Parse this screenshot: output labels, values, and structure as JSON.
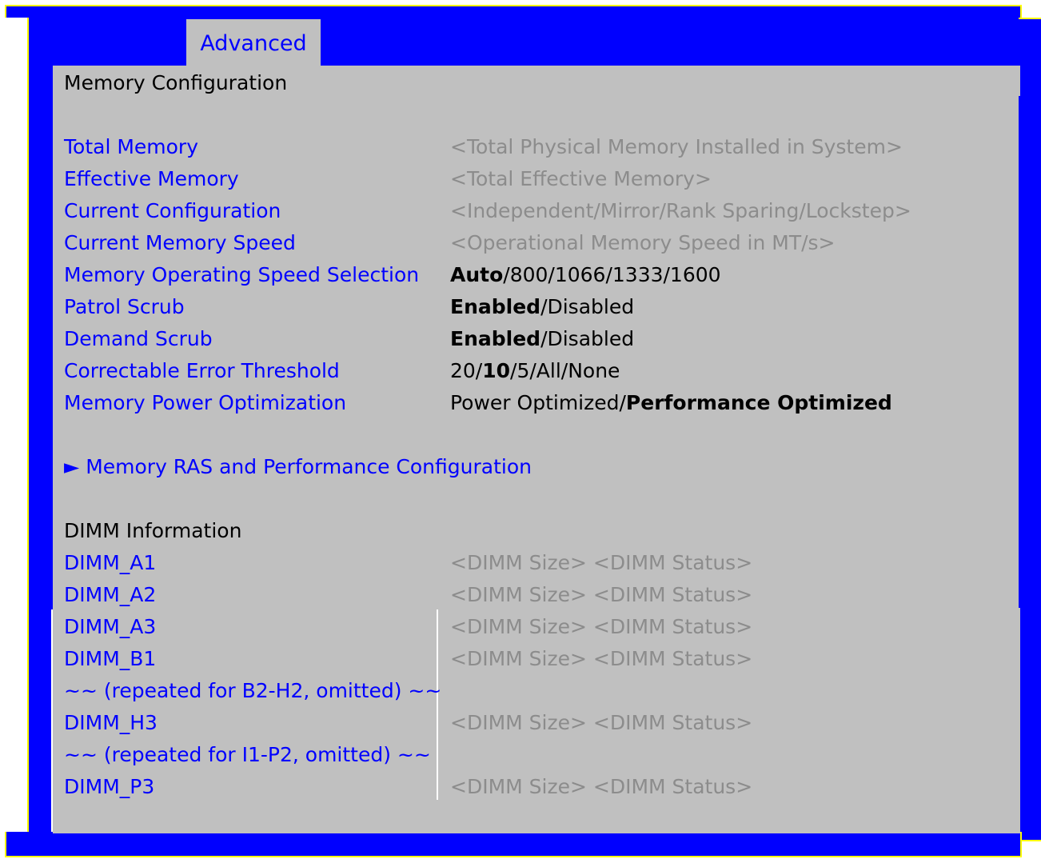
{
  "tab": {
    "label": "Advanced"
  },
  "page_title": "Memory Configuration",
  "settings": [
    {
      "label": "Total Memory",
      "value": "<Total Physical Memory Installed in System>"
    },
    {
      "label": "Effective Memory",
      "value": "<Total Effective Memory>"
    },
    {
      "label": "Current Configuration",
      "value": "<Independent/Mirror/Rank Sparing/Lockstep>"
    },
    {
      "label": "Current Memory Speed",
      "value": "<Operational Memory Speed in MT/s>"
    },
    {
      "label": "Memory Operating Speed Selection",
      "default": "Auto",
      "rest": "/800/1066/1333/1600"
    },
    {
      "label": "Patrol Scrub",
      "default": "Enabled",
      "rest": "/Disabled"
    },
    {
      "label": "Demand Scrub",
      "default": "Enabled",
      "rest": "/Disabled"
    },
    {
      "label": "Correctable Error Threshold",
      "pre": "20/",
      "default": "10",
      "rest": "/5/All/None"
    },
    {
      "label": "Memory Power Optimization",
      "pre": "Power Optimized/",
      "default": "Performance Optimized"
    }
  ],
  "submenu": {
    "arrow": "►",
    "label": "Memory RAS and Performance Configuration"
  },
  "dimm_section": {
    "heading": "DIMM Information",
    "rows": [
      {
        "label": "DIMM_A1",
        "value": "<DIMM Size> <DIMM Status>"
      },
      {
        "label": "DIMM_A2",
        "value": "<DIMM Size> <DIMM Status>"
      },
      {
        "label": "DIMM_A3",
        "value": "<DIMM Size> <DIMM Status>"
      },
      {
        "label": "DIMM_B1",
        "value": "<DIMM Size> <DIMM Status>"
      },
      {
        "label": "~~ (repeated for B2-H2, omitted) ~~",
        "value": ""
      },
      {
        "label": "DIMM_H3",
        "value": "<DIMM Size> <DIMM Status>"
      },
      {
        "label": "~~ (repeated for I1-P2, omitted) ~~",
        "value": ""
      },
      {
        "label": "DIMM_P3",
        "value": "<DIMM Size> <DIMM Status>"
      }
    ]
  },
  "colors": {
    "frame": "#0000ff",
    "edge": "#ffff00",
    "panel": "#c0c0c0",
    "label": "#0000ff",
    "info": "#8c8c8c"
  }
}
